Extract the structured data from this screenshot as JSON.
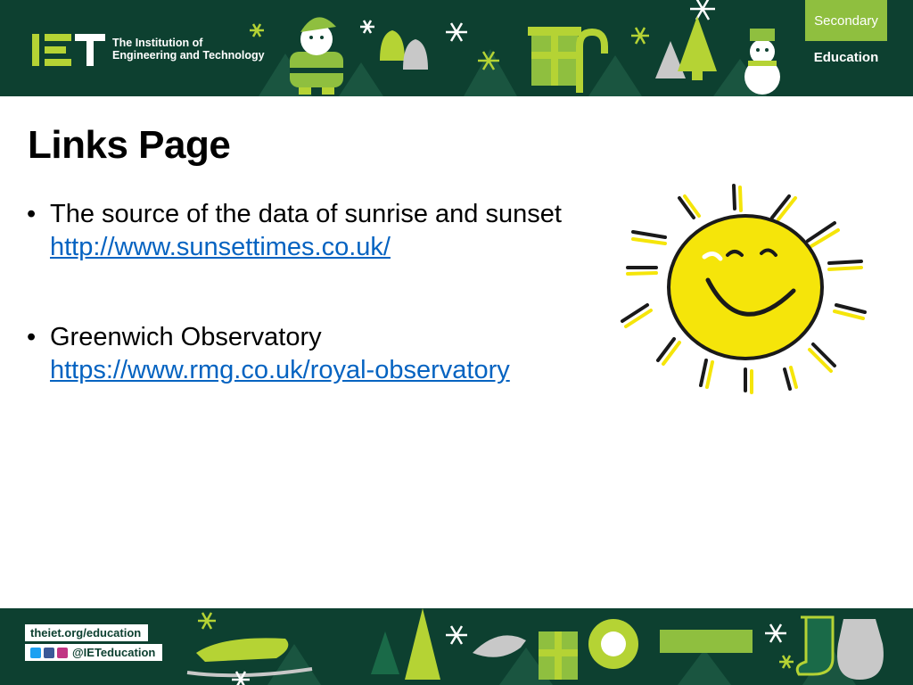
{
  "header": {
    "org_line1": "The Institution of",
    "org_line2": "Engineering and Technology",
    "secondary_label": "Secondary",
    "education_label": "Education",
    "colors": {
      "banner": "#0d4030",
      "accent": "#b5d334",
      "secondary_box": "#8fbf3f"
    }
  },
  "main": {
    "title": "Links Page",
    "bullet_symbol": "•",
    "items": [
      {
        "text": "The source of the data of sunrise and sunset ",
        "link": "http://www.sunsettimes.co.uk/"
      },
      {
        "text": "Greenwich Observatory ",
        "link": "https://www.rmg.co.uk/royal-observatory"
      }
    ],
    "link_color": "#0563c1"
  },
  "illustration": {
    "icon": "smiling-sun-icon",
    "color": "#f5e50a"
  },
  "footer": {
    "website": "theiet.org/education",
    "social_handle": "@IETeducation",
    "social_icons": [
      "twitter-icon",
      "facebook-icon",
      "instagram-icon"
    ]
  }
}
